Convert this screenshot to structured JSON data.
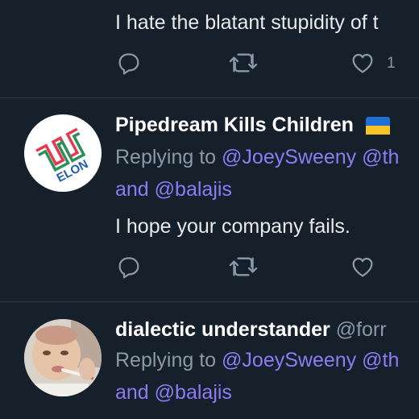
{
  "tweets": [
    {
      "text": "I hate the blatant stupidity of t",
      "actions": {
        "like_count": "1"
      }
    },
    {
      "author_name": "Pipedream Kills Children",
      "replying_prefix": "Replying to",
      "mention_1": "@JoeySweeny",
      "mention_2": "@th",
      "and_label": "and",
      "mention_3": "@balajis",
      "text": "I hope your company fails.",
      "avatar_logo_text": "ELON"
    },
    {
      "author_name": "dialectic understander",
      "author_handle": "@forr",
      "replying_prefix": "Replying to",
      "mention_1": "@JoeySweeny",
      "mention_2": "@th",
      "and_label": "and",
      "mention_3": "@balajis"
    }
  ],
  "colors": {
    "background": "#15202b",
    "link": "#8b7cf6",
    "muted": "#8b98a5",
    "divider": "#2f3b48"
  },
  "icons": [
    "reply-icon",
    "retweet-icon",
    "like-icon",
    "ukraine-flag-icon"
  ]
}
